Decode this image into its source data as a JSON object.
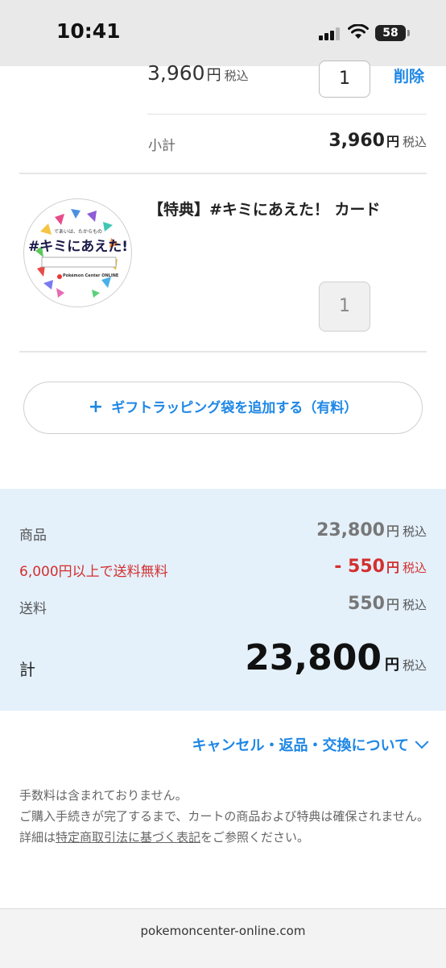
{
  "status_bar": {
    "time": "10:41",
    "battery": "58"
  },
  "cart": {
    "item1": {
      "price": "3,960",
      "yen": "円",
      "tax": "税込",
      "qty": "1",
      "delete": "削除",
      "subtotal_label": "小計",
      "subtotal_value": "3,960",
      "subtotal_yen": "円",
      "subtotal_tax": "税込"
    },
    "item2": {
      "title": "【特典】#キミにあえた！ カード",
      "qty": "1",
      "image_brand": "Pokémon Center ONLINE"
    }
  },
  "gift_button": {
    "label": "ギフトラッピング袋を追加する（有料）"
  },
  "summary": {
    "products_label": "商品",
    "products_value": "23,800",
    "discount_label": "6,000円以上で送料無料",
    "discount_value": "- 550",
    "shipping_label": "送料",
    "shipping_value": "550",
    "yen": "円",
    "tax": "税込",
    "total_label": "計",
    "total_value": "23,800",
    "colors": {
      "bg": "#e4f1fb",
      "discount": "#d32f2f",
      "accent": "#1e87e5"
    }
  },
  "cancel_link": "キャンセル・返品・交換について",
  "notes": {
    "line1": "手数料は含まれておりません。",
    "line2": "ご購入手続きが完了するまで、カートの商品および特典は確保されません。",
    "line3_pre": "詳細は",
    "line3_link": "特定商取引法に基づく表記",
    "line3_post": "をご参照ください。"
  },
  "browser": {
    "url": "pokemoncenter-online.com"
  }
}
